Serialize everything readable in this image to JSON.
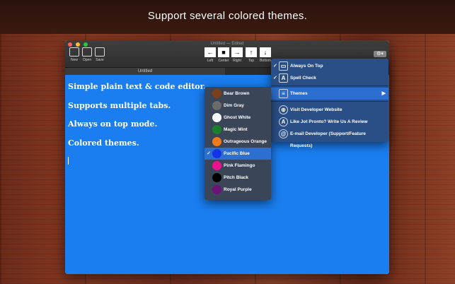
{
  "headline": "Support several colored themes.",
  "window": {
    "title": "Untitled — Edited",
    "toolbar": {
      "new": "New",
      "open": "Open",
      "save": "Save",
      "left": "Left",
      "center": "Center",
      "right": "Right",
      "top": "Top",
      "bottom": "Bottom"
    },
    "tab_label": "Untitled"
  },
  "editor": {
    "lines": [
      "Simple plain text & code editor.",
      "Supports multiple tabs.",
      "Always on top mode.",
      "Colored themes."
    ],
    "background_color": "#1a7ef0"
  },
  "gear_menu": {
    "items": [
      {
        "label": "Always On Top",
        "checked": true,
        "icon": "window-icon"
      },
      {
        "label": "Spell Check",
        "checked": true,
        "icon": "spellcheck-icon"
      },
      {
        "label": "Themes",
        "checked": false,
        "icon": "themes-icon",
        "submenu": true
      },
      {
        "label": "Visit Developer Website",
        "checked": false,
        "icon": "globe-icon"
      },
      {
        "label": "Like Jot Pronto? Write Us A Review",
        "checked": false,
        "icon": "appstore-icon"
      },
      {
        "label": "E-mail Developer (Support/Feature Requests)",
        "checked": false,
        "icon": "at-icon"
      }
    ]
  },
  "themes_menu": {
    "items": [
      {
        "label": "Bear Brown",
        "color": "#7b3f1c",
        "checked": false
      },
      {
        "label": "Dim Gray",
        "color": "#6b6b6b",
        "checked": false
      },
      {
        "label": "Ghost White",
        "color": "#f8f8ff",
        "checked": false
      },
      {
        "label": "Magic Mint",
        "color": "#1a7f2a",
        "checked": false
      },
      {
        "label": "Outrageous Orange",
        "color": "#f07a1e",
        "checked": false
      },
      {
        "label": "Pacific Blue",
        "color": "#1233e8",
        "checked": true
      },
      {
        "label": "Pink Flamingo",
        "color": "#e9138f",
        "checked": false
      },
      {
        "label": "Pitch Black",
        "color": "#000000",
        "checked": false
      },
      {
        "label": "Royal Purple",
        "color": "#6a1378",
        "checked": false
      }
    ]
  }
}
